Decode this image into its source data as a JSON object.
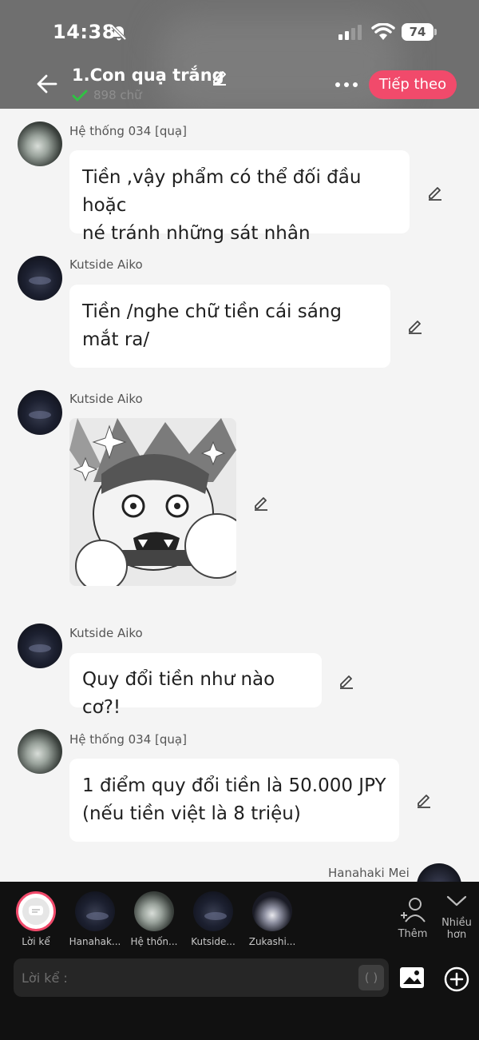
{
  "status_bar": {
    "time": "14:38",
    "battery": "74"
  },
  "header": {
    "title": "1.Con quạ trắng",
    "word_count": "898 chữ",
    "next_label": "Tiếp theo"
  },
  "messages": [
    {
      "sender": "Hệ thống 034 [quạ]",
      "text_line1": "Tiền ,vậy phẩm có thể đối đầu hoặc",
      "text_line2": "né tránh những sát nhân"
    },
    {
      "sender": "Kutside Aiko",
      "text_line1": "Tiền /nghe chữ tiền cái sáng",
      "text_line2": "mắt ra/"
    },
    {
      "sender": "Kutside Aiko",
      "image": "manga-panel"
    },
    {
      "sender": "Kutside Aiko",
      "text_line1": "Quy đổi tiền như nào cơ?!"
    },
    {
      "sender": "Hệ thống 034 [quạ]",
      "text_line1": "1 điểm quy đổi tiền là 50.000 JPY",
      "text_line2": "(nếu tiền việt là 8 triệu)"
    },
    {
      "sender": "Hanahaki Mei"
    }
  ],
  "characters": [
    {
      "label": "Lời kể"
    },
    {
      "label": "Hanahak..."
    },
    {
      "label": "Hệ thốn..."
    },
    {
      "label": "Kutside..."
    },
    {
      "label": "Zukashi..."
    }
  ],
  "tools": {
    "add_character": "Thêm",
    "more_line1": "Nhiều",
    "more_line2": "hơn"
  },
  "composer": {
    "placeholder": "Lời kể :",
    "paren": "( )"
  },
  "colors": {
    "accent": "#f14a6b",
    "header_bg": "#6f6f6f",
    "panel_bg": "#111111",
    "chat_bg": "#f4f4f4"
  }
}
